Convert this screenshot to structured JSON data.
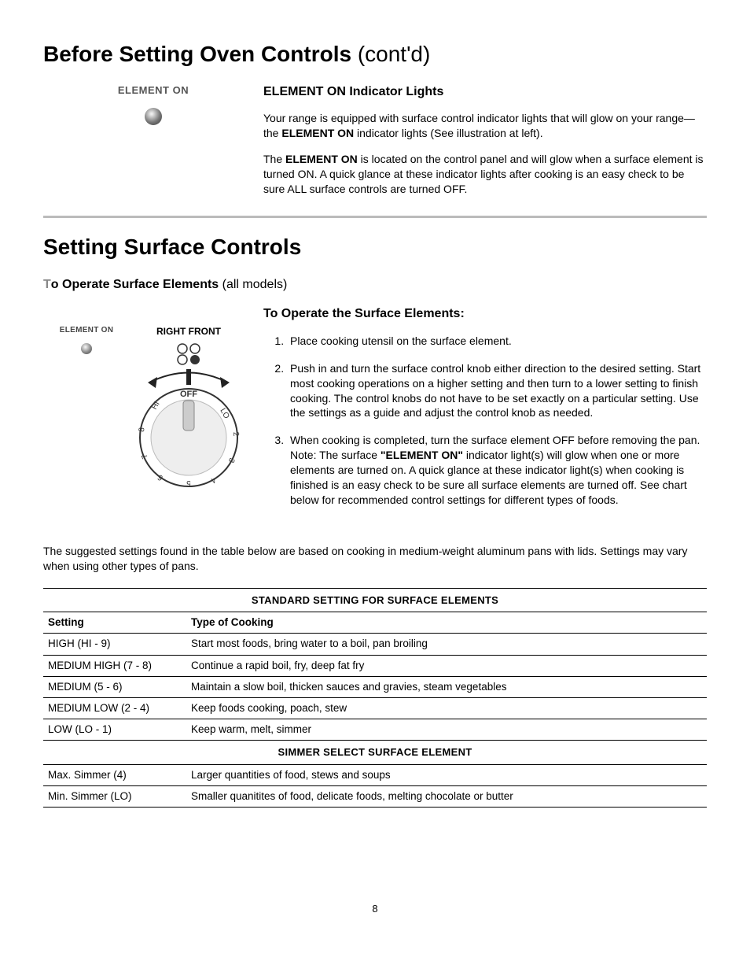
{
  "title_bold": "Before Setting Oven Controls",
  "title_thin": " (cont'd)",
  "element_on_label": "ELEMENT ON",
  "sec1_heading": "ELEMENT ON Indicator Lights",
  "sec1_p1_a": "Your range is equipped with surface control indicator lights that will glow on your range— the ",
  "sec1_p1_b": "ELEMENT ON",
  "sec1_p1_c": " indicator lights (See illustration at left).",
  "sec1_p2_a": "The ",
  "sec1_p2_b": "ELEMENT ON",
  "sec1_p2_c": " is located on the control panel and will glow when a surface element is turned ON. A quick glance at these indicator lights after cooking is an easy check to be sure ALL surface controls are turned OFF.",
  "h2_bold": "Setting Surface Controls",
  "h2sub_bold": "To Operate Surface Elements",
  "h2sub_thin": " (all models)",
  "knob_elem_on": "ELEMENT ON",
  "knob_rf": "RIGHT FRONT",
  "knob_off": "OFF",
  "sec2_heading": "To Operate the Surface Elements:",
  "op1": "Place cooking utensil on the surface element.",
  "op2": "Push in and turn the surface control knob either direction to the desired setting. Start most cooking operations on a higher setting and then turn to a lower setting to finish cooking. The control knobs do not have to be set exactly on a particular setting. Use the settings as a guide and adjust the control knob as needed.",
  "op3_a": "When cooking is completed, turn the surface element OFF before removing the pan. Note: The surface ",
  "op3_b": "\"ELEMENT ON\"",
  "op3_c": " indicator light(s) will glow when one or more elements are turned on. A quick glance at these indicator light(s) when cooking is finished is an easy check to be sure all surface elements are turned off. See chart below for recommended control settings for different types of foods.",
  "note": "The suggested settings found in the table below are based on cooking in medium-weight aluminum pans with lids. Settings may vary when using other types of pans.",
  "table1_title": "STANDARD SETTING FOR SURFACE ELEMENTS",
  "col_setting": "Setting",
  "col_type": "Type of Cooking",
  "chart_data": {
    "type": "table",
    "title": "STANDARD SETTING FOR SURFACE ELEMENTS",
    "columns": [
      "Setting",
      "Type of Cooking"
    ],
    "rows": [
      [
        "HIGH (HI - 9)",
        "Start most foods, bring water to a boil, pan broiling"
      ],
      [
        "MEDIUM HIGH (7 - 8)",
        "Continue a rapid boil, fry, deep fat fry"
      ],
      [
        "MEDIUM (5 - 6)",
        "Maintain a slow boil, thicken sauces and gravies, steam vegetables"
      ],
      [
        "MEDIUM LOW (2 - 4)",
        "Keep foods cooking, poach, stew"
      ],
      [
        "LOW (LO - 1)",
        "Keep warm, melt, simmer"
      ]
    ],
    "subtitle": "SIMMER SELECT SURFACE ELEMENT",
    "rows2": [
      [
        "Max. Simmer (4)",
        "Larger quantities of food, stews and soups"
      ],
      [
        "Min. Simmer (LO)",
        "Smaller quanitites of food, delicate foods, melting chocolate or butter"
      ]
    ]
  },
  "table2_title": "SIMMER SELECT SURFACE ELEMENT",
  "t1": [
    {
      "s": "HIGH (HI - 9)",
      "c": "Start most foods, bring water to a boil, pan broiling"
    },
    {
      "s": "MEDIUM HIGH (7 - 8)",
      "c": "Continue a rapid boil, fry, deep fat fry"
    },
    {
      "s": "MEDIUM (5 - 6)",
      "c": "Maintain a slow boil, thicken sauces and gravies, steam vegetables"
    },
    {
      "s": "MEDIUM LOW (2 - 4)",
      "c": "Keep foods cooking, poach, stew"
    },
    {
      "s": "LOW (LO - 1)",
      "c": "Keep warm, melt, simmer"
    }
  ],
  "t2": [
    {
      "s": "Max. Simmer (4)",
      "c": "Larger quantities of food, stews and soups"
    },
    {
      "s": "Min. Simmer (LO)",
      "c": "Smaller quanitites of food, delicate foods, melting chocolate or butter"
    }
  ],
  "page_number": "8"
}
